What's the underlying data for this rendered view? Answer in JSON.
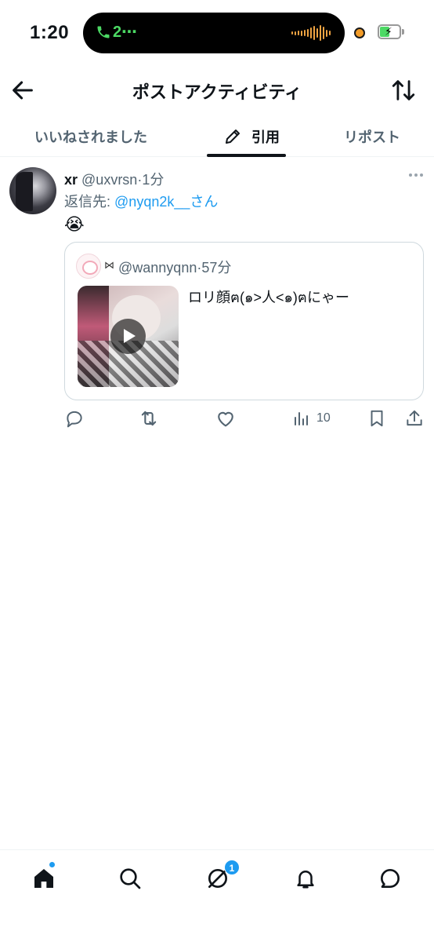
{
  "status_bar": {
    "time": "1:20",
    "call_count": "2⋯",
    "call_color": "#4cd964",
    "audio_wave_color": "#f0a442",
    "battery_color": "#4cd964"
  },
  "header": {
    "title": "ポストアクティビティ",
    "back_icon": "arrow-left-icon",
    "sort_icon": "sort-arrows-icon"
  },
  "tabs": [
    {
      "label": "いいねされました",
      "active": false
    },
    {
      "label": "引用",
      "active": true,
      "icon": "pencil-icon"
    },
    {
      "label": "リポスト",
      "active": false
    }
  ],
  "tweet": {
    "name": "xr",
    "handle": "@uxvrsn",
    "separator": "·",
    "time": "1分",
    "reply_prefix": "返信先:",
    "reply_to": "@nyqn2k__さん",
    "emoji": "😭",
    "quote": {
      "ribbon": "⋈",
      "handle": "@wannyqnn",
      "separator": "·",
      "time": "57分",
      "text": "ロリ顔ฅ(๑>人<๑)ฅにゃー",
      "media": "video-thumbnail"
    },
    "actions": {
      "views": "10"
    },
    "accent_color": "#1d9bf0"
  },
  "bottom_nav": {
    "items": [
      "home-icon",
      "search-icon",
      "grok-icon",
      "bell-icon",
      "messages-icon"
    ],
    "grok_badge": "1"
  }
}
